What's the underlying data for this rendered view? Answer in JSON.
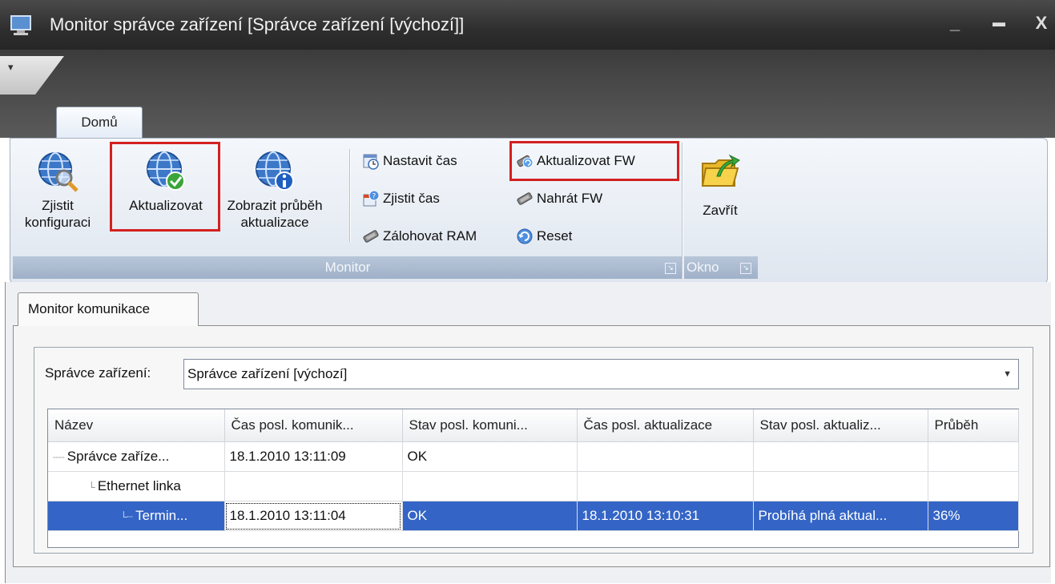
{
  "window": {
    "title": "Monitor správce zařízení [Správce zařízení [výchozí]]",
    "minimize": "_",
    "maximize": "▬",
    "close": "X"
  },
  "ribbon": {
    "qat_arrow": "▾",
    "tab_home": "Domů",
    "monitor_group": {
      "label": "Monitor",
      "detect_config": [
        "Zjistit",
        "konfiguraci"
      ],
      "update": "Aktualizovat",
      "show_progress": [
        "Zobrazit průběh",
        "aktualizace"
      ],
      "set_time": "Nastavit čas",
      "get_time": "Zjistit čas",
      "backup_ram": "Zálohovat RAM",
      "update_fw": "Aktualizovat FW",
      "upload_fw": "Nahrát FW",
      "reset": "Reset"
    },
    "window_group": {
      "label": "Okno",
      "close": "Zavřít"
    }
  },
  "pane": {
    "tab": "Monitor komunikace",
    "device_label": "Správce zařízení:",
    "device_value": "Správce zařízení [výchozí]",
    "grid": {
      "columns": [
        "Název",
        "Čas posl. komunik...",
        "Stav posl. komuni...",
        "Čas posl. aktualizace",
        "Stav posl. aktualiz...",
        "Průběh"
      ],
      "rows": [
        {
          "name": "Správce zaříze...",
          "comm_time": "18.1.2010 13:11:09",
          "comm_state": "OK",
          "upd_time": "",
          "upd_state": "",
          "progress": ""
        },
        {
          "name": "Ethernet linka",
          "comm_time": "",
          "comm_state": "",
          "upd_time": "",
          "upd_state": "",
          "progress": ""
        },
        {
          "name": "Termin...",
          "comm_time": "18.1.2010 13:11:04",
          "comm_state": "OK",
          "upd_time": "18.1.2010 13:10:31",
          "upd_state": "Probíhá plná aktual...",
          "progress": "36%"
        }
      ]
    }
  },
  "colors": {
    "highlight_box": "#d32020",
    "selection": "#3465c6",
    "title_bar": "#2e2e2e"
  }
}
